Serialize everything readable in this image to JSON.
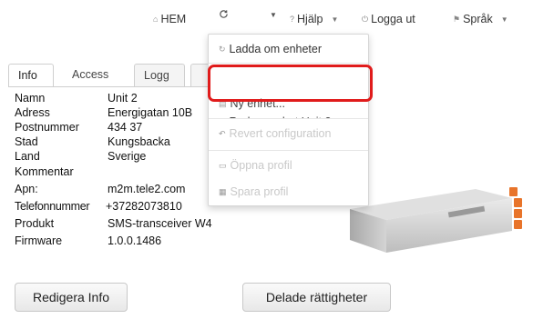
{
  "nav": {
    "home": "HEM",
    "refresh_icon": "refresh-icon",
    "help": "Hjälp",
    "logout": "Logga ut",
    "language": "Språk"
  },
  "tabs": [
    {
      "label": "Info",
      "active": true
    },
    {
      "label": "Access",
      "active": false
    },
    {
      "label": "Logg",
      "active": false
    }
  ],
  "info": [
    {
      "label": "Namn",
      "value": "Unit 2"
    },
    {
      "label": "Adress",
      "value": "Energigatan 10B"
    },
    {
      "label": "Postnummer",
      "value": "434 37"
    },
    {
      "label": "Stad",
      "value": "Kungsbacka"
    },
    {
      "label": "Land",
      "value": "Sverige"
    },
    {
      "label": "Kommentar",
      "value": ""
    },
    {
      "label": "Apn:",
      "value": "m2m.tele2.com"
    },
    {
      "label": "Telefonnummer",
      "value": "+37282073810"
    },
    {
      "label": "Produkt",
      "value": "SMS-transceiver W4"
    },
    {
      "label": "Firmware",
      "value": "1.0.0.1486"
    }
  ],
  "buttons": {
    "edit_info": "Redigera Info",
    "shared_rights": "Delade rättigheter"
  },
  "dropdown": {
    "reload": "Ladda om enheter",
    "new_unit": "Ny enhet...",
    "remove_unit": "Radera enhet Unit 2...",
    "revert": "Revert configuration",
    "open_profile": "Öppna profil",
    "save_profile": "Spara profil"
  },
  "colors": {
    "highlight": "#e01b1b",
    "disabled_text": "#c9c9c9"
  }
}
